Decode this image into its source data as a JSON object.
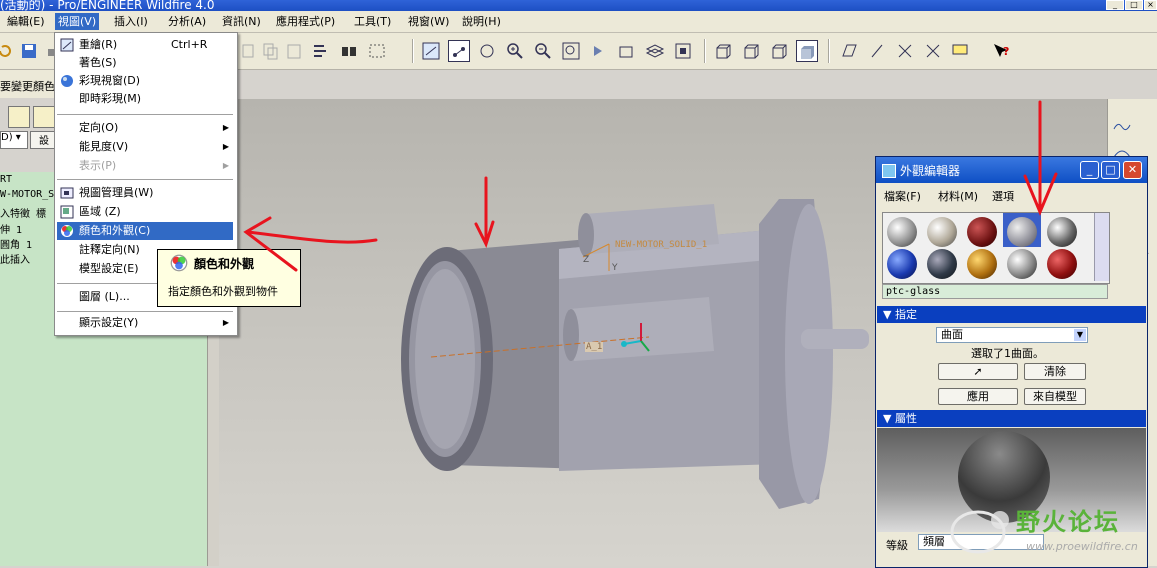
{
  "window": {
    "title": "(活動的) - Pro/ENGINEER Wildfire 4.0"
  },
  "menubar": {
    "items": [
      {
        "label": "編輯(E)"
      },
      {
        "label": "視圖(V)"
      },
      {
        "label": "插入(I)"
      },
      {
        "label": "分析(A)"
      },
      {
        "label": "資訊(N)"
      },
      {
        "label": "應用程式(P)"
      },
      {
        "label": "工具(T)"
      },
      {
        "label": "視窗(W)"
      },
      {
        "label": "說明(H)"
      }
    ]
  },
  "view_menu": {
    "items": [
      {
        "label": "重繪(R)",
        "shortcut": "Ctrl+R",
        "icon": "repaint-icon"
      },
      {
        "label": "著色(S)"
      },
      {
        "label": "彩現視窗(D)",
        "icon": "render-window-icon"
      },
      {
        "label": "即時彩現(M)"
      },
      {
        "label": "定向(O)",
        "submenu": true
      },
      {
        "label": "能見度(V)",
        "submenu": true
      },
      {
        "label": "表示(P)",
        "submenu": true,
        "disabled": true
      },
      {
        "label": "視圖管理員(W)",
        "icon": "view-manager-icon"
      },
      {
        "label": "區域 (Z)",
        "icon": "region-icon"
      },
      {
        "label": "顏色和外觀(C)",
        "icon": "color-appearance-icon",
        "highlighted": true
      },
      {
        "label": "註釋定向(N)"
      },
      {
        "label": "模型設定(E)"
      },
      {
        "label": "圖層 (L)..."
      },
      {
        "label": "顯示設定(Y)",
        "submenu": true
      }
    ]
  },
  "tooltip": {
    "title": "顏色和外觀",
    "description": "指定顏色和外觀到物件"
  },
  "left_panel": {
    "row_text": "要變更顏色的",
    "dropdown_value": "D)",
    "button_label": "設",
    "tree": [
      "RT",
      "W-MOTOR_S",
      "入特徵 標",
      "伸 1",
      "圓角 1",
      "此插入"
    ]
  },
  "viewport": {
    "label_top": "NEW-MOTOR_SOLID_1",
    "label_small": "A_1",
    "axis_z": "Z",
    "axis_y": "Y"
  },
  "appearance_editor": {
    "title": "外觀編輯器",
    "menus": [
      "檔案(F)",
      "材料(M)",
      "選項"
    ],
    "material_name": "ptc-glass",
    "assign_section": "指定",
    "assign_type": "曲面",
    "status": "選取了1曲面。",
    "clear_button": "清除",
    "apply_button": "應用",
    "from_model_button": "來自模型",
    "properties_section": "屬性",
    "level_label": "等級",
    "level_value": "頻層",
    "plus": "+",
    "minus": "—"
  },
  "watermark": {
    "text": "野火论坛",
    "url": "www.proewildfire.cn"
  },
  "colors": {
    "highlight": "#316ac5",
    "section_blue": "#0a3fbf",
    "annotation_red": "#e8141e",
    "tree_green": "#c7e4c6"
  }
}
